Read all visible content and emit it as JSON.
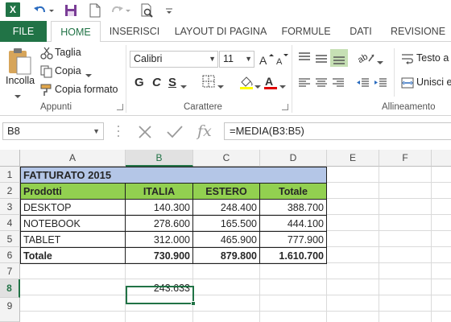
{
  "qat": {
    "app_letter": "X"
  },
  "tabs": [
    {
      "label": "FILE"
    },
    {
      "label": "HOME"
    },
    {
      "label": "INSERISCI"
    },
    {
      "label": "LAYOUT DI PAGINA"
    },
    {
      "label": "FORMULE"
    },
    {
      "label": "DATI"
    },
    {
      "label": "REVISIONE"
    }
  ],
  "clipboard": {
    "paste_label": "Incolla",
    "cut_label": "Taglia",
    "copy_label": "Copia",
    "format_painter_label": "Copia formato",
    "group_label": "Appunti"
  },
  "font": {
    "family": "Calibri",
    "size": "11",
    "bold": "G",
    "italic": "C",
    "underline": "S",
    "group_label": "Carattere"
  },
  "alignment": {
    "wrap_text_label": "Testo a",
    "merge_label": "Unisci e",
    "group_label": "Allineamento"
  },
  "formula_bar": {
    "name_box": "B8",
    "fx": "fx",
    "formula": "=MEDIA(B3:B5)"
  },
  "columns": [
    "A",
    "B",
    "C",
    "D",
    "E",
    "F"
  ],
  "rows": [
    "1",
    "2",
    "3",
    "4",
    "5",
    "6",
    "7",
    "8",
    "9"
  ],
  "sheet": {
    "title": "FATTURATO 2015",
    "headers": [
      "Prodotti",
      "ITALIA",
      "ESTERO",
      "Totale"
    ],
    "data": [
      [
        "DESKTOP",
        "140.300",
        "248.400",
        "388.700"
      ],
      [
        "NOTEBOOK",
        "278.600",
        "165.500",
        "444.100"
      ],
      [
        "TABLET",
        "312.000",
        "465.900",
        "777.900"
      ]
    ],
    "total": [
      "Totale",
      "730.900",
      "879.800",
      "1.610.700"
    ],
    "average": "243.633"
  },
  "colors": {
    "accent": "#217346",
    "title_fill": "#b4c6e7",
    "header_fill": "#92d050"
  }
}
